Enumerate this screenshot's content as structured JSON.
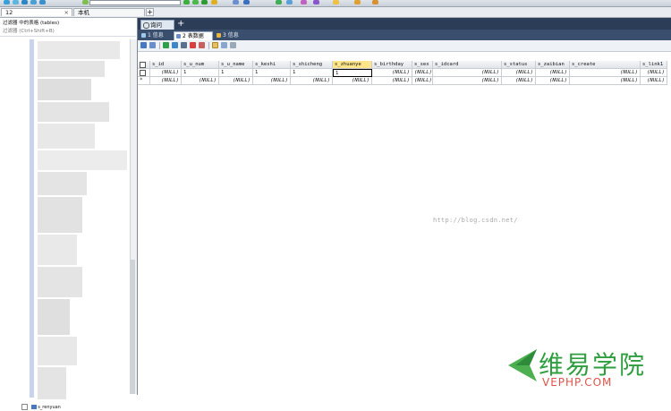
{
  "colors": {
    "accent_dark": "#2b3d57",
    "selected_header": "#ffe58a",
    "brand_green": "#2e9e3e",
    "brand_red": "#e0534a"
  },
  "tabs": [
    {
      "label": "12",
      "close": "×"
    },
    {
      "label": "本机"
    }
  ],
  "tab_add": "+",
  "sidebar": {
    "filter_line1": "过滤器  中的表格 (tables)",
    "filter_line2": "过滤器  (Ctrl+Shift+B)",
    "last_node": "s_renyuan"
  },
  "query_tab": {
    "label": "询问",
    "icon": "query-icon",
    "add": "+"
  },
  "result_tabs": [
    {
      "label": "1 信息",
      "icon": "info-icon"
    },
    {
      "label": "2 表数据",
      "icon": "table-icon"
    },
    {
      "label": "3 信息",
      "icon": "info-icon"
    }
  ],
  "grid": {
    "columns": [
      "s_id",
      "s_u_num",
      "s_u_name",
      "s_keshi",
      "s_shicheng",
      "s_zhuanye",
      "s_birthday",
      "s_sex",
      "s_idcard",
      "s_status",
      "s_zaibian",
      "s_create",
      "s_link1"
    ],
    "selected_column": "s_zhuanye",
    "rows": [
      [
        "(NULL)",
        "1",
        "1",
        "1",
        "1",
        "1",
        "(NULL)",
        "(NULL)",
        "(NULL)",
        "(NULL)",
        "(NULL)",
        "(NULL)",
        "(NULL)"
      ],
      [
        "(NULL)",
        "(NULL)",
        "(NULL)",
        "(NULL)",
        "(NULL)",
        "(NULL)",
        "(NULL)",
        "(NULL)",
        "(NULL)",
        "(NULL)",
        "(NULL)",
        "(NULL)",
        "(NULL)"
      ]
    ],
    "row_marker": "*"
  },
  "watermark": "http://blog.csdn.net/",
  "brand": {
    "name_cn": "维易学院",
    "name_en": "VEPHP.COM"
  }
}
